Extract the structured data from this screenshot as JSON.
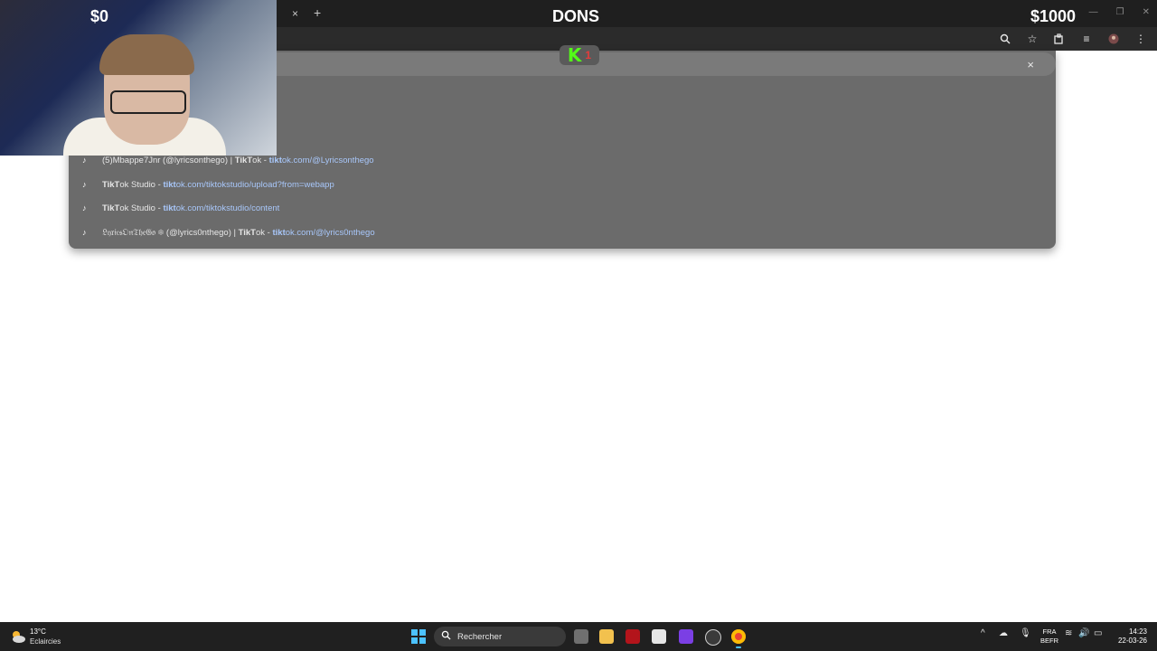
{
  "overlay": {
    "left_amount": "$0",
    "title": "DONS",
    "right_amount": "$1000"
  },
  "kick": {
    "logo": "K",
    "count": "1"
  },
  "browser": {
    "tab_close": "×",
    "tab_new": "+",
    "omnibox_clear": "×"
  },
  "suggestions": [
    {
      "title_pre": "(5)Mbappe7Jnr (@lyricsonthego) | ",
      "title_bold": "TikT",
      "title_post": "ok",
      "sep": " - ",
      "url_bold": "tikt",
      "url_rest": "ok.com/@Lyricsonthego"
    },
    {
      "title_pre": "",
      "title_bold": "TikT",
      "title_post": "ok Studio",
      "sep": " - ",
      "url_bold": "tikt",
      "url_rest": "ok.com/tiktokstudio/upload?from=webapp"
    },
    {
      "title_pre": "",
      "title_bold": "TikT",
      "title_post": "ok Studio",
      "sep": " - ",
      "url_bold": "tikt",
      "url_rest": "ok.com/tiktokstudio/content"
    },
    {
      "title_pre": "𝔏𝔶𝔯𝔦𝔠𝔰𝔒𝔫𝔗𝔥𝔢𝔊𝔬 ❄ (@lyrics0nthego) | ",
      "title_bold": "TikT",
      "title_post": "ok",
      "sep": " - ",
      "url_bold": "tikt",
      "url_rest": "ok.com/@lyrics0nthego"
    }
  ],
  "taskbar": {
    "weather_temp": "13°C",
    "weather_desc": "Eclaircies",
    "search_label": "Rechercher",
    "lang_top": "FRA",
    "lang_bottom": "BEFR",
    "time": "14:23",
    "date": "22-03-26"
  },
  "icons": {
    "tiktok": "tiktok-icon",
    "search": "search-icon",
    "zoom": "zoom-icon",
    "star": "bookmark-star-icon",
    "extensions": "extensions-icon",
    "menu": "menu-icon"
  },
  "colors": {
    "kick_green": "#53fc18",
    "url_blue": "#a8c7fa",
    "accent": "#4cc2ff"
  }
}
